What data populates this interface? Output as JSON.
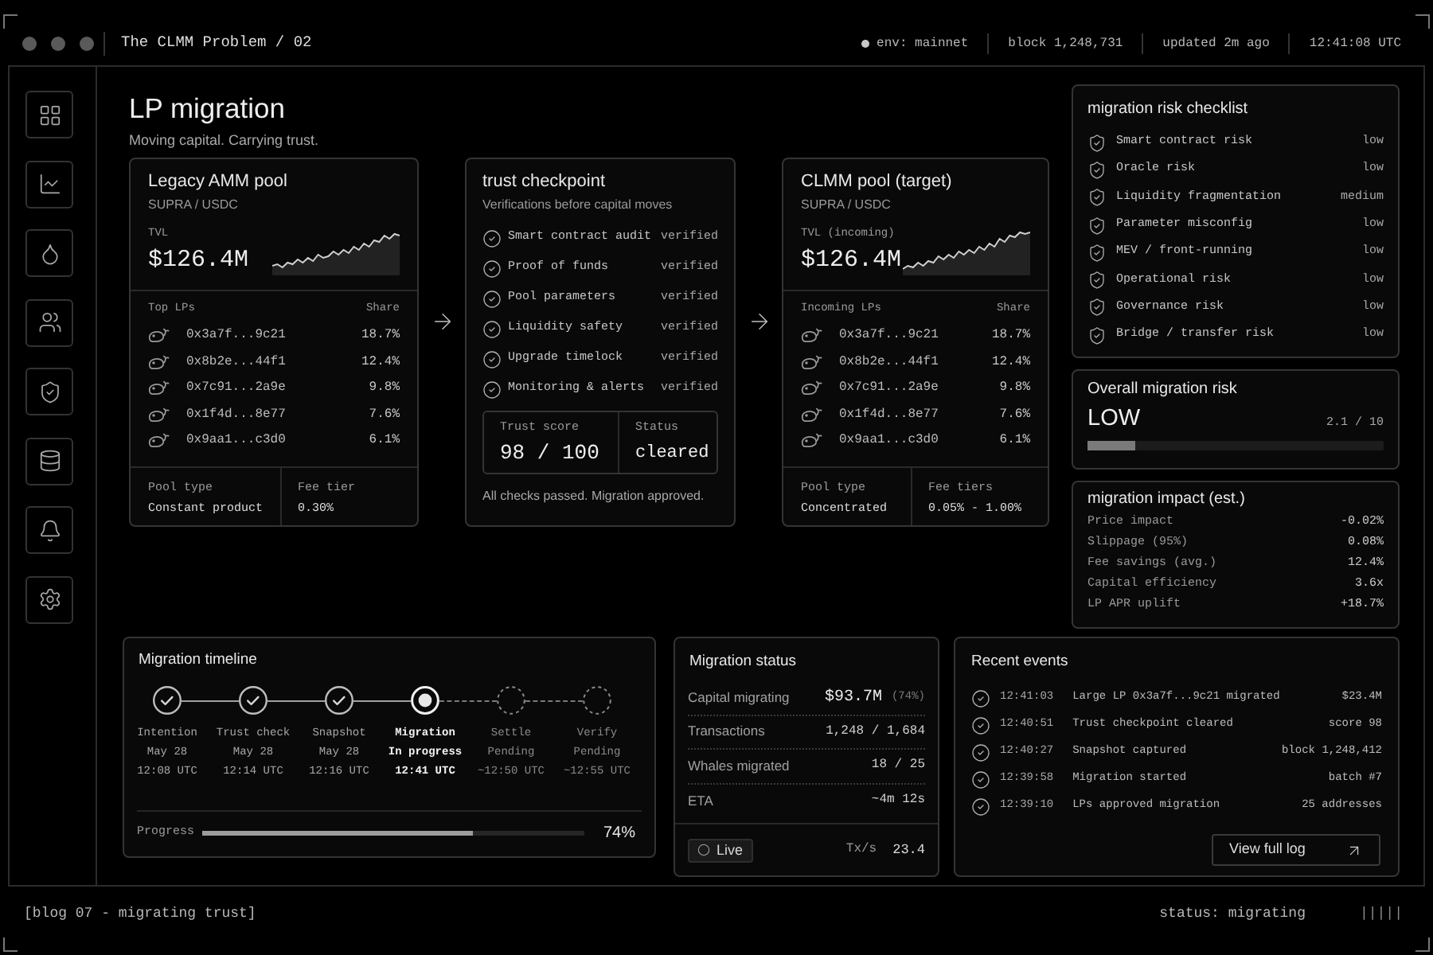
{
  "window": {
    "title": "The CLMM Problem / 02"
  },
  "header": {
    "env": "env: mainnet",
    "block": "block 1,248,731",
    "updated": "updated 2m ago",
    "clock": "12:41:08 UTC"
  },
  "page": {
    "title": "LP migration",
    "subtitle": "Moving capital. Carrying trust."
  },
  "legacy_pool": {
    "title": "Legacy AMM pool",
    "pair": "SUPRA / USDC",
    "tvl_label": "TVL",
    "tvl": "$126.4M",
    "lp_header": "Top LPs",
    "share_header": "Share",
    "lps": [
      {
        "address": "0x3a7f...9c21",
        "share": "18.7%"
      },
      {
        "address": "0x8b2e...44f1",
        "share": "12.4%"
      },
      {
        "address": "0x7c91...2a9e",
        "share": "9.8%"
      },
      {
        "address": "0x1f4d...8e77",
        "share": "7.6%"
      },
      {
        "address": "0x9aa1...c3d0",
        "share": "6.1%"
      }
    ],
    "footer": [
      {
        "label": "Pool type",
        "value": "Constant product"
      },
      {
        "label": "Fee tier",
        "value": "0.30%"
      }
    ]
  },
  "trust_checkpoint": {
    "title": "trust checkpoint",
    "subtitle": "Verifications before capital moves",
    "checks": [
      {
        "label": "Smart contract audit",
        "status": "verified"
      },
      {
        "label": "Proof of funds",
        "status": "verified"
      },
      {
        "label": "Pool parameters",
        "status": "verified"
      },
      {
        "label": "Liquidity safety",
        "status": "verified"
      },
      {
        "label": "Upgrade timelock",
        "status": "verified"
      },
      {
        "label": "Monitoring & alerts",
        "status": "verified"
      }
    ],
    "score": {
      "label": "Trust score",
      "value": "98 / 100"
    },
    "status": {
      "label": "Status",
      "value": "cleared"
    },
    "note": "All checks passed. Migration approved."
  },
  "clmm_pool": {
    "title": "CLMM pool (target)",
    "pair": "SUPRA / USDC",
    "tvl_label": "TVL (incoming)",
    "tvl": "$126.4M",
    "lp_header": "Incoming LPs",
    "share_header": "Share",
    "lps": [
      {
        "address": "0x3a7f...9c21",
        "share": "18.7%"
      },
      {
        "address": "0x8b2e...44f1",
        "share": "12.4%"
      },
      {
        "address": "0x7c91...2a9e",
        "share": "9.8%"
      },
      {
        "address": "0x1f4d...8e77",
        "share": "7.6%"
      },
      {
        "address": "0x9aa1...c3d0",
        "share": "6.1%"
      }
    ],
    "footer": [
      {
        "label": "Pool type",
        "value": "Concentrated"
      },
      {
        "label": "Fee tiers",
        "value": "0.05% - 1.00%"
      }
    ]
  },
  "risk_checklist": {
    "title": "migration risk checklist",
    "items": [
      {
        "label": "Smart contract risk",
        "rating": "low"
      },
      {
        "label": "Oracle risk",
        "rating": "low"
      },
      {
        "label": "Liquidity fragmentation",
        "rating": "medium"
      },
      {
        "label": "Parameter misconfig",
        "rating": "low"
      },
      {
        "label": "MEV / front-running",
        "rating": "low"
      },
      {
        "label": "Operational risk",
        "rating": "low"
      },
      {
        "label": "Governance risk",
        "rating": "low"
      },
      {
        "label": "Bridge / transfer risk",
        "rating": "low"
      }
    ]
  },
  "overall_risk": {
    "title": "Overall migration risk",
    "rating": "LOW",
    "score": "2.1 / 10",
    "level": 0.16
  },
  "impact": {
    "title": "migration impact (est.)",
    "rows": [
      {
        "label": "Price impact",
        "value": "-0.02%"
      },
      {
        "label": "Slippage (95%)",
        "value": "0.08%"
      },
      {
        "label": "Fee savings (avg.)",
        "value": "12.4%"
      },
      {
        "label": "Capital efficiency",
        "value": "3.6x"
      },
      {
        "label": "LP APR uplift",
        "value": "+18.7%"
      }
    ]
  },
  "timeline": {
    "title": "Migration timeline",
    "steps": [
      {
        "name": "Intention",
        "date": "May 28",
        "time": "12:08 UTC",
        "kind": "done"
      },
      {
        "name": "Trust check",
        "date": "May 28",
        "time": "12:14 UTC",
        "kind": "done"
      },
      {
        "name": "Snapshot",
        "date": "May 28",
        "time": "12:16 UTC",
        "kind": "done"
      },
      {
        "name": "Migration",
        "date": "In progress",
        "time": "12:41 UTC",
        "kind": "current"
      },
      {
        "name": "Settle",
        "date": "Pending",
        "time": "~12:50 UTC",
        "kind": "pending"
      },
      {
        "name": "Verify",
        "date": "Pending",
        "time": "~12:55 UTC",
        "kind": "pending"
      }
    ],
    "progress": {
      "label": "Progress",
      "level": 0.71,
      "reading": "74%"
    }
  },
  "migration_status": {
    "title": "Migration status",
    "rows": [
      {
        "kind": "primary",
        "label": "Capital migrating",
        "value": "$93.7M",
        "note": "(74%)"
      },
      {
        "kind": "plain",
        "label": "Transactions",
        "value": "1,248 / 1,684"
      },
      {
        "kind": "plain",
        "label": "Whales migrated",
        "value": "18 / 25"
      },
      {
        "kind": "plain",
        "label": "ETA",
        "value": "~4m 12s"
      }
    ],
    "live": "Live",
    "rate_label": "Tx/s",
    "rate": "23.4"
  },
  "recent_events": {
    "title": "Recent events",
    "events": [
      {
        "time": "12:41:03",
        "text": "Large LP 0x3a7f...9c21 migrated",
        "value": "$23.4M"
      },
      {
        "time": "12:40:51",
        "text": "Trust checkpoint cleared",
        "value": "score 98"
      },
      {
        "time": "12:40:27",
        "text": "Snapshot captured",
        "value": "block 1,248,412"
      },
      {
        "time": "12:39:58",
        "text": "Migration started",
        "value": "batch #7"
      },
      {
        "time": "12:39:10",
        "text": "LPs approved migration",
        "value": "25 addresses"
      }
    ],
    "button": "View full log"
  },
  "footer": {
    "label": "[blog 07 - migrating trust]",
    "status": "status: migrating",
    "marks": "|||||"
  }
}
